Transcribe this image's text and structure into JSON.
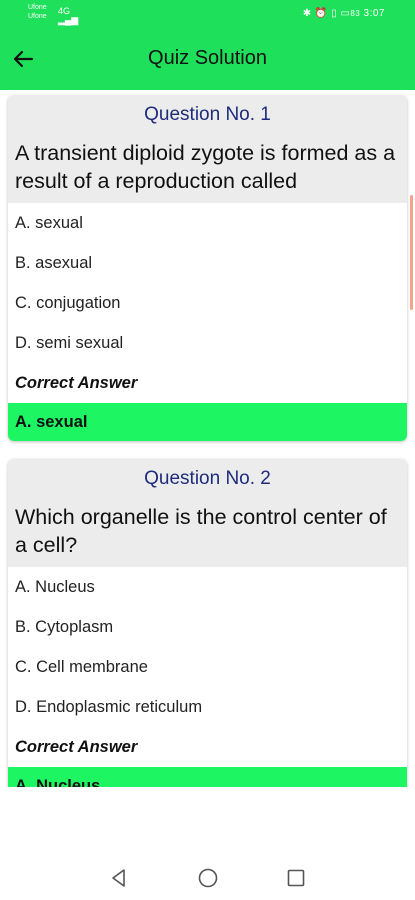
{
  "status": {
    "carrier1": "Ufone",
    "carrier2": "Ufone",
    "signal": "4G",
    "time": "3:07",
    "battery": "83"
  },
  "header": {
    "title": "Quiz Solution",
    "back_icon": "arrow-left-icon"
  },
  "questions": [
    {
      "header": "Question No.  1",
      "text": "A transient diploid zygote is formed as a result of a reproduction called",
      "options": [
        "A. sexual",
        "B. asexual",
        "C. conjugation",
        "D. semi sexual"
      ],
      "correct_label": "Correct Answer",
      "answer": "A. sexual"
    },
    {
      "header": "Question No.  2",
      "text": "Which organelle is the control center of a cell?",
      "options": [
        "A. Nucleus",
        "B. Cytoplasm",
        "C. Cell membrane",
        "D. Endoplasmic reticulum"
      ],
      "correct_label": "Correct Answer",
      "answer": "A. Nucleus"
    }
  ],
  "colors": {
    "accent": "#1ee05a",
    "answer_bg": "#1ef563",
    "header_text": "#1d2c7c"
  },
  "navigation": {
    "back": "triangle-back-icon",
    "home": "circle-home-icon",
    "recents": "square-recents-icon"
  }
}
